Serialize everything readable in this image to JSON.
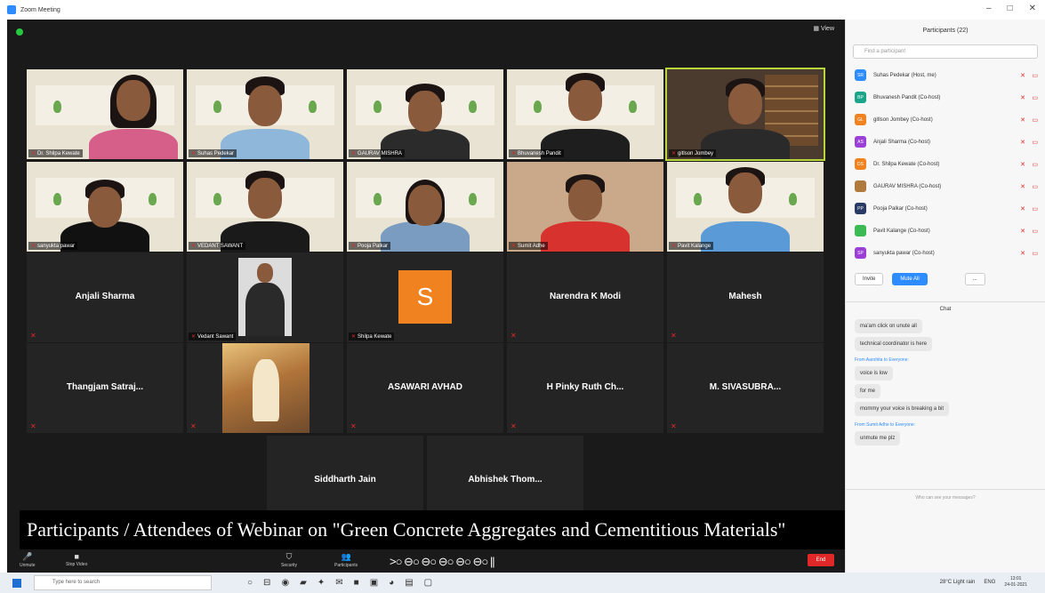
{
  "window": {
    "title": "Zoom Meeting",
    "controls": [
      "–",
      "□",
      "✕"
    ]
  },
  "meeting": {
    "view_label": "View"
  },
  "video_tiles": [
    {
      "caption": "Dr. Shilpa Kewate"
    },
    {
      "caption": "Suhas Pedekar"
    },
    {
      "caption": "GAURAV MISHRA"
    },
    {
      "caption": "Bhuvanesh Pandit"
    },
    {
      "caption": "gitlson Jombey"
    },
    {
      "caption": "sanyukta pawar"
    },
    {
      "caption": "VEDANT SAWANT"
    },
    {
      "caption": "Pooja Palkar"
    },
    {
      "caption": "Sumit Adhe"
    },
    {
      "caption": "Pavit Kalange"
    }
  ],
  "name_tiles": {
    "row3": [
      "Anjali Sharma",
      "Vedant Sawant",
      "Shilpa Kewate",
      "Narendra K Modi",
      "Mahesh"
    ],
    "row4": [
      "Thangjam Satraj...",
      "",
      "ASAWARI AVHAD",
      "H Pinky Ruth Ch...",
      "M. SIVASUBRA..."
    ],
    "row5": [
      "Siddharth Jain",
      "Abhishek Thom..."
    ],
    "avatar_letter": "S"
  },
  "caption_banner": "Participants / Attendees of Webinar on \"Green Concrete Aggregates and Cementitious Materials\"",
  "toolbar": {
    "items": [
      "Unmute",
      "Stop Video",
      "Security",
      "Participants"
    ],
    "end_label": "End"
  },
  "participants": {
    "header": "Participants (22)",
    "search_placeholder": "Find a participant",
    "list": [
      {
        "initials": "SR",
        "name": "Suhas Pedekar (Host, me)",
        "color": "#2d8cff"
      },
      {
        "initials": "BP",
        "name": "Bhuvanesh Pandit (Co-host)",
        "color": "#1aa58a"
      },
      {
        "initials": "GL",
        "name": "gitlson Jombey (Co-host)",
        "color": "#f0821f"
      },
      {
        "initials": "AS",
        "name": "Anjali Sharma (Co-host)",
        "color": "#9c3fd6"
      },
      {
        "initials": "DS",
        "name": "Dr. Shilpa Kewate (Co-host)",
        "color": "#f0821f"
      },
      {
        "initials": "",
        "name": "GAURAV MISHRA (Co-host)",
        "color": "#b07a3c"
      },
      {
        "initials": "PP",
        "name": "Pooja Palkar (Co-host)",
        "color": "#2a3a66"
      },
      {
        "initials": "",
        "name": "Pavit Kalange (Co-host)",
        "color": "#3cba54"
      },
      {
        "initials": "SP",
        "name": "sanyukta pawar (Co-host)",
        "color": "#9c3fd6"
      }
    ],
    "invite_label": "Invite",
    "mute_all_label": "Mute All",
    "more_label": "..."
  },
  "chat": {
    "header": "Chat",
    "messages": [
      {
        "from": "",
        "text": "ma'am click on unute all"
      },
      {
        "from": "",
        "text": "technical coordinator is here"
      },
      {
        "from": "From Aarohita to Everyone:",
        "text": "voice is low"
      },
      {
        "from": "",
        "text": "for me"
      },
      {
        "from": "",
        "text": "mommy your voice is breaking a bit"
      },
      {
        "from": "From Sumit Adhe to Everyone:",
        "text": "unmute me plz"
      }
    ],
    "input_placeholder": "Who can see your messages?"
  },
  "taskbar": {
    "search_placeholder": "Type here to search",
    "weather": "28°C Light rain",
    "lang": "ENG",
    "time": "13:01",
    "date": "24-01-2021"
  },
  "colors": {
    "stage": "#1a1a1a",
    "accent": "#2d8cff",
    "end": "#e02828",
    "avatar": "#f0821f"
  }
}
